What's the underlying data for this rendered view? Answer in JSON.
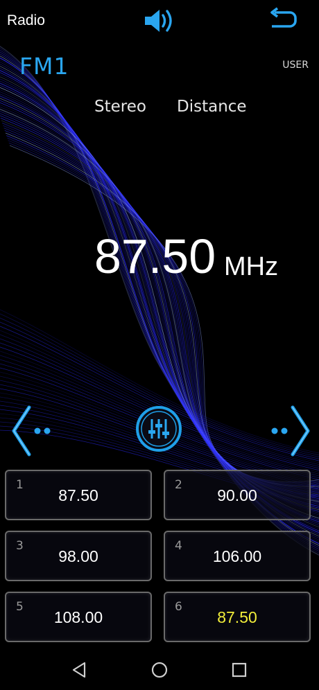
{
  "app": {
    "title": "Radio"
  },
  "status": {
    "band": "FM1",
    "mode": "USER",
    "stereo": "Stereo",
    "distance": "Distance"
  },
  "tuner": {
    "frequency": "87.50",
    "unit": "MHz"
  },
  "presets": [
    {
      "number": "1",
      "value": "87.50",
      "active": false
    },
    {
      "number": "2",
      "value": "90.00",
      "active": false
    },
    {
      "number": "3",
      "value": "98.00",
      "active": false
    },
    {
      "number": "4",
      "value": "106.00",
      "active": false
    },
    {
      "number": "5",
      "value": "108.00",
      "active": false
    },
    {
      "number": "6",
      "value": "87.50",
      "active": true
    }
  ],
  "colors": {
    "accent": "#2aa6f0",
    "active_preset": "#f2ee3a",
    "wave": "#2a2aff"
  },
  "icons": {
    "volume": "speaker-icon",
    "back": "return-arrow-icon",
    "prev": "seek-previous-icon",
    "next": "seek-next-icon",
    "eq": "equalizer-icon",
    "nav_back": "triangle-back-icon",
    "nav_home": "circle-home-icon",
    "nav_recents": "square-recents-icon"
  }
}
